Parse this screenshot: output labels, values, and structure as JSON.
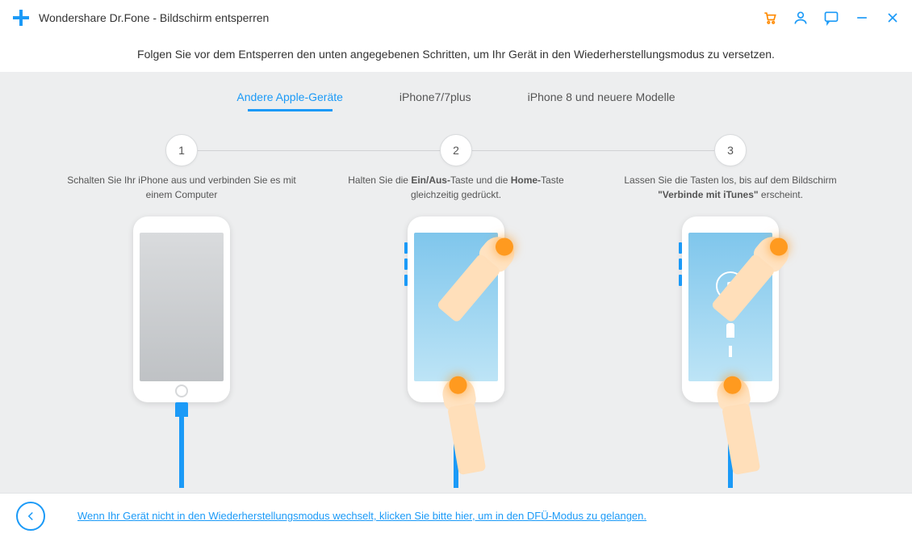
{
  "titlebar": {
    "title": "Wondershare Dr.Fone - Bildschirm entsperren"
  },
  "intro": "Folgen Sie vor dem Entsperren den unten angegebenen Schritten, um Ihr Gerät in den Wiederherstellungsmodus zu versetzen.",
  "tabs": [
    {
      "label": "Andere Apple-Geräte",
      "active": true
    },
    {
      "label": "iPhone7/7plus",
      "active": false
    },
    {
      "label": "iPhone 8 und neuere Modelle",
      "active": false
    }
  ],
  "steps": {
    "s1": "1",
    "s2": "2",
    "s3": "3",
    "desc1": "Schalten Sie Ihr iPhone aus und verbinden Sie es mit einem Computer",
    "desc2_pre": "Halten Sie die ",
    "desc2_b1": "Ein/Aus-",
    "desc2_mid": "Taste und die ",
    "desc2_b2": "Home-",
    "desc2_post": "Taste gleichzeitig gedrückt.",
    "desc3_pre": "Lassen Sie die Tasten los, bis auf dem Bildschirm ",
    "desc3_b": "\"Verbinde mit iTunes\"",
    "desc3_post": " erscheint."
  },
  "footer": {
    "link": "Wenn Ihr Gerät nicht in den Wiederherstellungsmodus wechselt, klicken Sie bitte hier, um in den DFÜ-Modus zu gelangen."
  }
}
